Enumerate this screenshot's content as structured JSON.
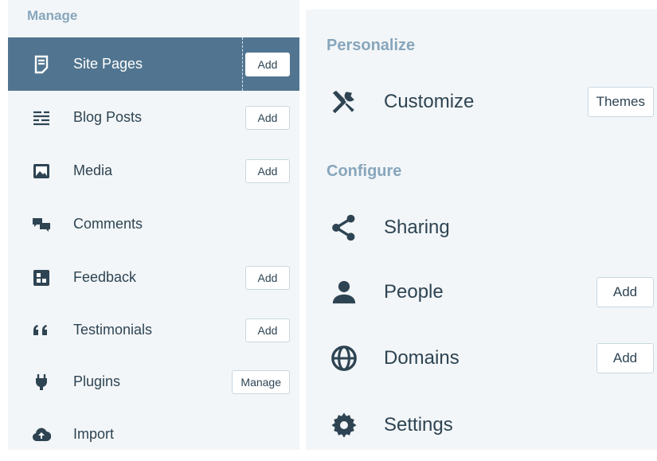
{
  "manage": {
    "header": "Manage",
    "items": [
      {
        "label": "Site Pages",
        "button": "Add",
        "icon": "page-icon"
      },
      {
        "label": "Blog Posts",
        "button": "Add",
        "icon": "posts-icon"
      },
      {
        "label": "Media",
        "button": "Add",
        "icon": "image-icon"
      },
      {
        "label": "Comments",
        "icon": "comments-icon"
      },
      {
        "label": "Feedback",
        "button": "Add",
        "icon": "feedback-icon"
      },
      {
        "label": "Testimonials",
        "button": "Add",
        "icon": "quote-icon"
      },
      {
        "label": "Plugins",
        "button": "Manage",
        "icon": "plug-icon"
      },
      {
        "label": "Import",
        "icon": "cloud-upload-icon"
      }
    ]
  },
  "personalize": {
    "header": "Personalize",
    "items": [
      {
        "label": "Customize",
        "button": "Themes",
        "icon": "tools-icon"
      }
    ]
  },
  "configure": {
    "header": "Configure",
    "items": [
      {
        "label": "Sharing",
        "icon": "share-icon"
      },
      {
        "label": "People",
        "button": "Add",
        "icon": "person-icon"
      },
      {
        "label": "Domains",
        "button": "Add",
        "icon": "globe-icon"
      },
      {
        "label": "Settings",
        "icon": "gear-icon"
      }
    ]
  },
  "colors": {
    "selected_bg": "#517590",
    "section_header": "#87a6bc",
    "text": "#2e4453"
  }
}
